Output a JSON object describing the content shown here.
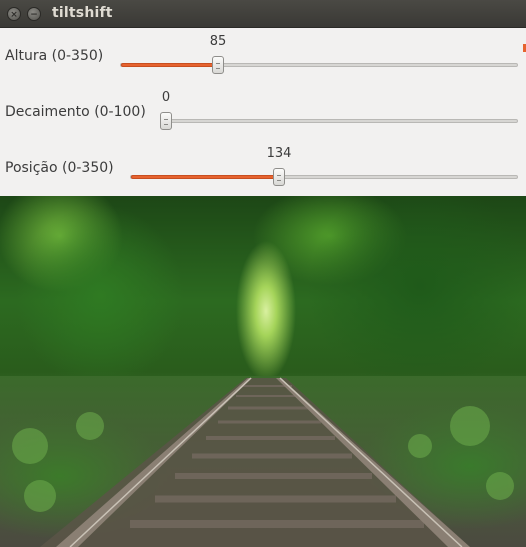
{
  "window": {
    "title": "tiltshift",
    "close_glyph": "×",
    "minimize_glyph": "−"
  },
  "sliders": [
    {
      "label": "Altura (0-350)",
      "value": "85",
      "min": 0,
      "max": 350,
      "fraction": 0.2429
    },
    {
      "label": "Decaimento (0-100)",
      "value": "0",
      "min": 0,
      "max": 100,
      "fraction": 0.0
    },
    {
      "label": "Posição (0-350)",
      "value": "134",
      "min": 0,
      "max": 350,
      "fraction": 0.3829
    }
  ],
  "image": {
    "icon": "forest-railway-photo"
  },
  "colors": {
    "accent": "#e6632f",
    "panel": "#f2f1f0",
    "titlebar": "#3c3b37"
  }
}
